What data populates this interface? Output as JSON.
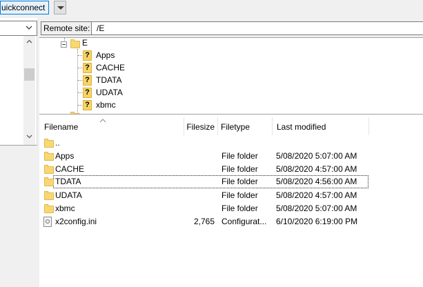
{
  "toolbar": {
    "quickconnect_label": "uickconnect"
  },
  "remote": {
    "site_label": "Remote site:",
    "path_value": "/E",
    "tree": {
      "root": "E",
      "children": [
        "Apps",
        "CACHE",
        "TDATA",
        "UDATA",
        "xbmc"
      ]
    },
    "columns": {
      "filename": "Filename",
      "filesize": "Filesize",
      "filetype": "Filetype",
      "last_modified": "Last modified"
    },
    "files": [
      {
        "name": "..",
        "size": "",
        "type": "",
        "modified": "",
        "icon": "folder-icon"
      },
      {
        "name": "Apps",
        "size": "",
        "type": "File folder",
        "modified": "5/08/2020 5:07:00 AM",
        "icon": "folder-icon"
      },
      {
        "name": "CACHE",
        "size": "",
        "type": "File folder",
        "modified": "5/08/2020 4:57:00 AM",
        "icon": "folder-icon"
      },
      {
        "name": "TDATA",
        "size": "",
        "type": "File folder",
        "modified": "5/08/2020 4:56:00 AM",
        "icon": "folder-icon"
      },
      {
        "name": "UDATA",
        "size": "",
        "type": "File folder",
        "modified": "5/08/2020 4:57:00 AM",
        "icon": "folder-icon"
      },
      {
        "name": "xbmc",
        "size": "",
        "type": "File folder",
        "modified": "5/08/2020 5:07:00 AM",
        "icon": "folder-icon"
      },
      {
        "name": "x2config.ini",
        "size": "2,765",
        "type": "Configurat...",
        "modified": "6/10/2020 6:19:00 PM",
        "icon": "config-file-icon"
      }
    ]
  }
}
